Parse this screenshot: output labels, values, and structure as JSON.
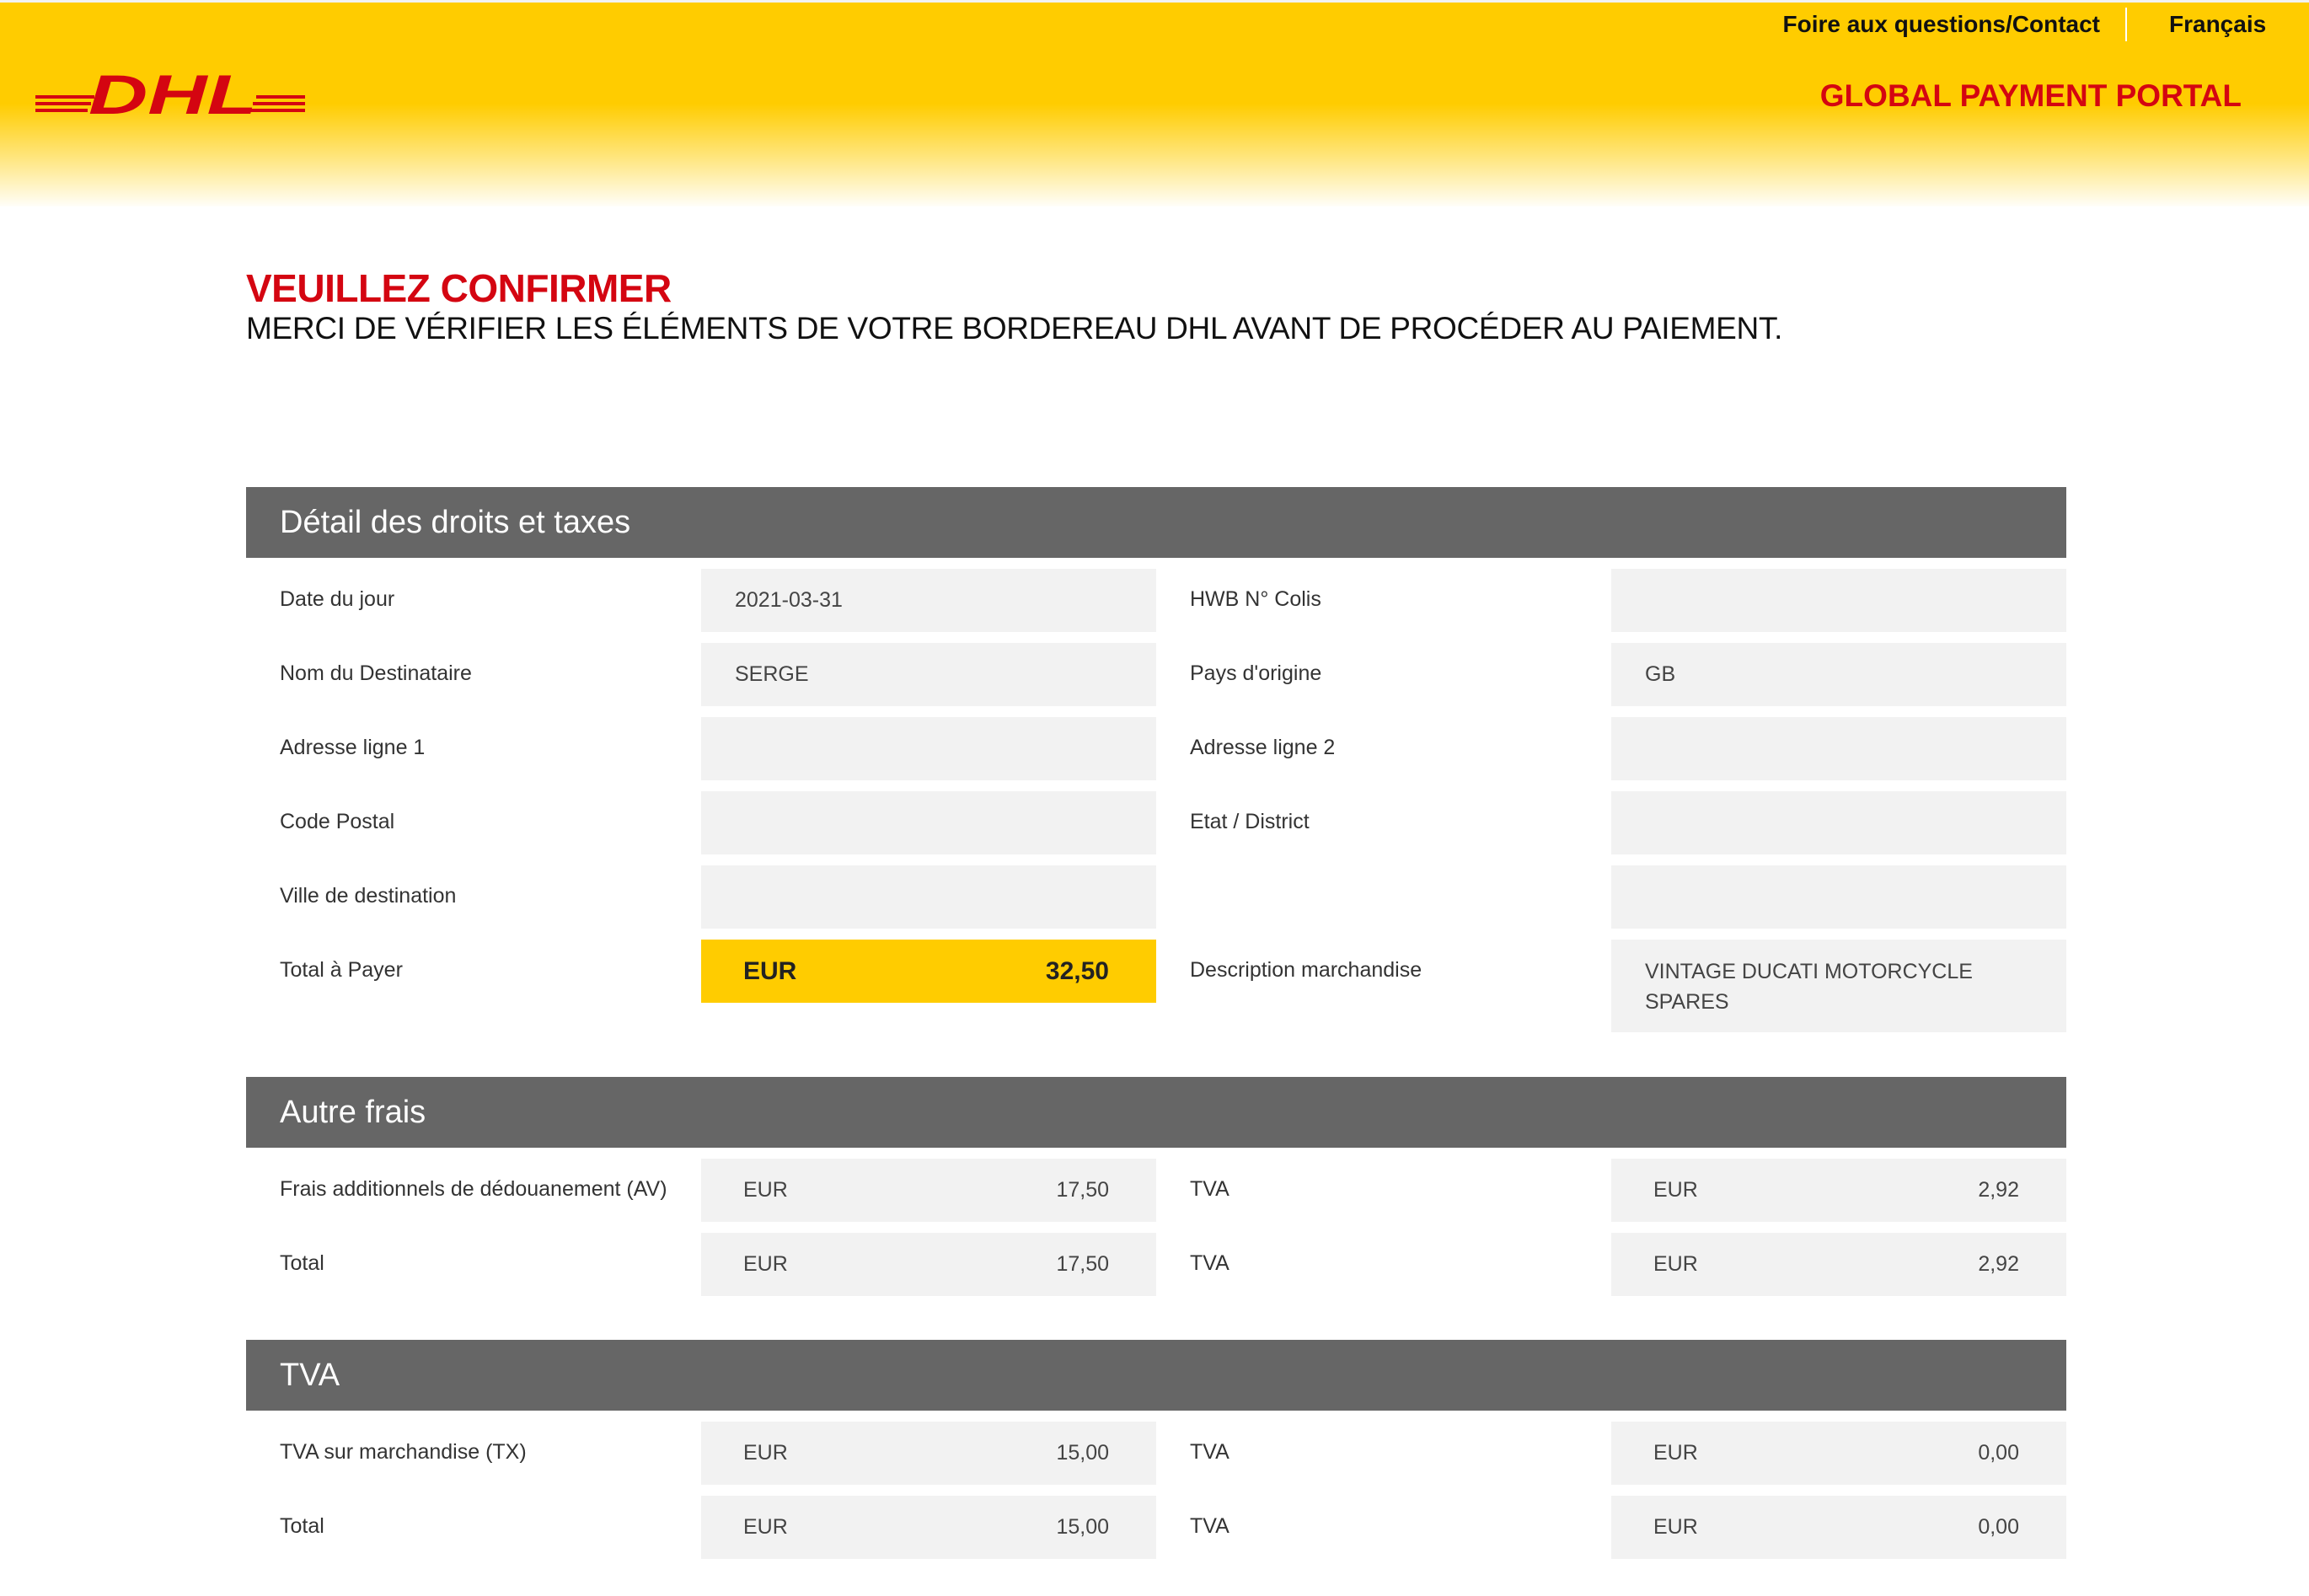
{
  "header": {
    "logo_text": "DHL",
    "faq_link": "Foire aux questions/Contact",
    "language": "Français",
    "portal_title": "GLOBAL PAYMENT PORTAL",
    "brand_colors": {
      "yellow": "#ffcc00",
      "red": "#d40511",
      "section_gray": "#666666"
    }
  },
  "page": {
    "title": "VEUILLEZ CONFIRMER",
    "subtitle": "MERCI DE VÉRIFIER LES ÉLÉMENTS DE VOTRE BORDEREAU DHL AVANT DE PROCÉDER AU PAIEMENT."
  },
  "duties": {
    "heading": "Détail des droits et taxes",
    "date_label": "Date du jour",
    "date_value": "2021-03-31",
    "hwb_label": "HWB N° Colis",
    "hwb_value": "",
    "recipient_label": "Nom du Destinataire",
    "recipient_value": "SERGE",
    "origin_label": "Pays d'origine",
    "origin_value": "GB",
    "address1_label": "Adresse ligne 1",
    "address1_value": "",
    "address2_label": "Adresse ligne 2",
    "address2_value": "",
    "postal_label": "Code Postal",
    "postal_value": "",
    "state_label": "Etat / District",
    "state_value": "",
    "city_label": "Ville de destination",
    "city_value": "",
    "extra_value": "",
    "total_label": "Total à Payer",
    "total_currency": "EUR",
    "total_amount": "32,50",
    "desc_label": "Description marchandise",
    "desc_value": "VINTAGE DUCATI MOTORCYCLE SPARES"
  },
  "other_fees": {
    "heading": "Autre frais",
    "rows": [
      {
        "label": "Frais additionnels de dédouanement (AV)",
        "currency": "EUR",
        "amount": "17,50",
        "vat_label": "TVA",
        "vat_currency": "EUR",
        "vat_amount": "2,92"
      },
      {
        "label": "Total",
        "currency": "EUR",
        "amount": "17,50",
        "vat_label": "TVA",
        "vat_currency": "EUR",
        "vat_amount": "2,92"
      }
    ]
  },
  "vat": {
    "heading": "TVA",
    "rows": [
      {
        "label": "TVA sur marchandise (TX)",
        "currency": "EUR",
        "amount": "15,00",
        "vat_label": "TVA",
        "vat_currency": "EUR",
        "vat_amount": "0,00"
      },
      {
        "label": "Total",
        "currency": "EUR",
        "amount": "15,00",
        "vat_label": "TVA",
        "vat_currency": "EUR",
        "vat_amount": "0,00"
      }
    ]
  }
}
